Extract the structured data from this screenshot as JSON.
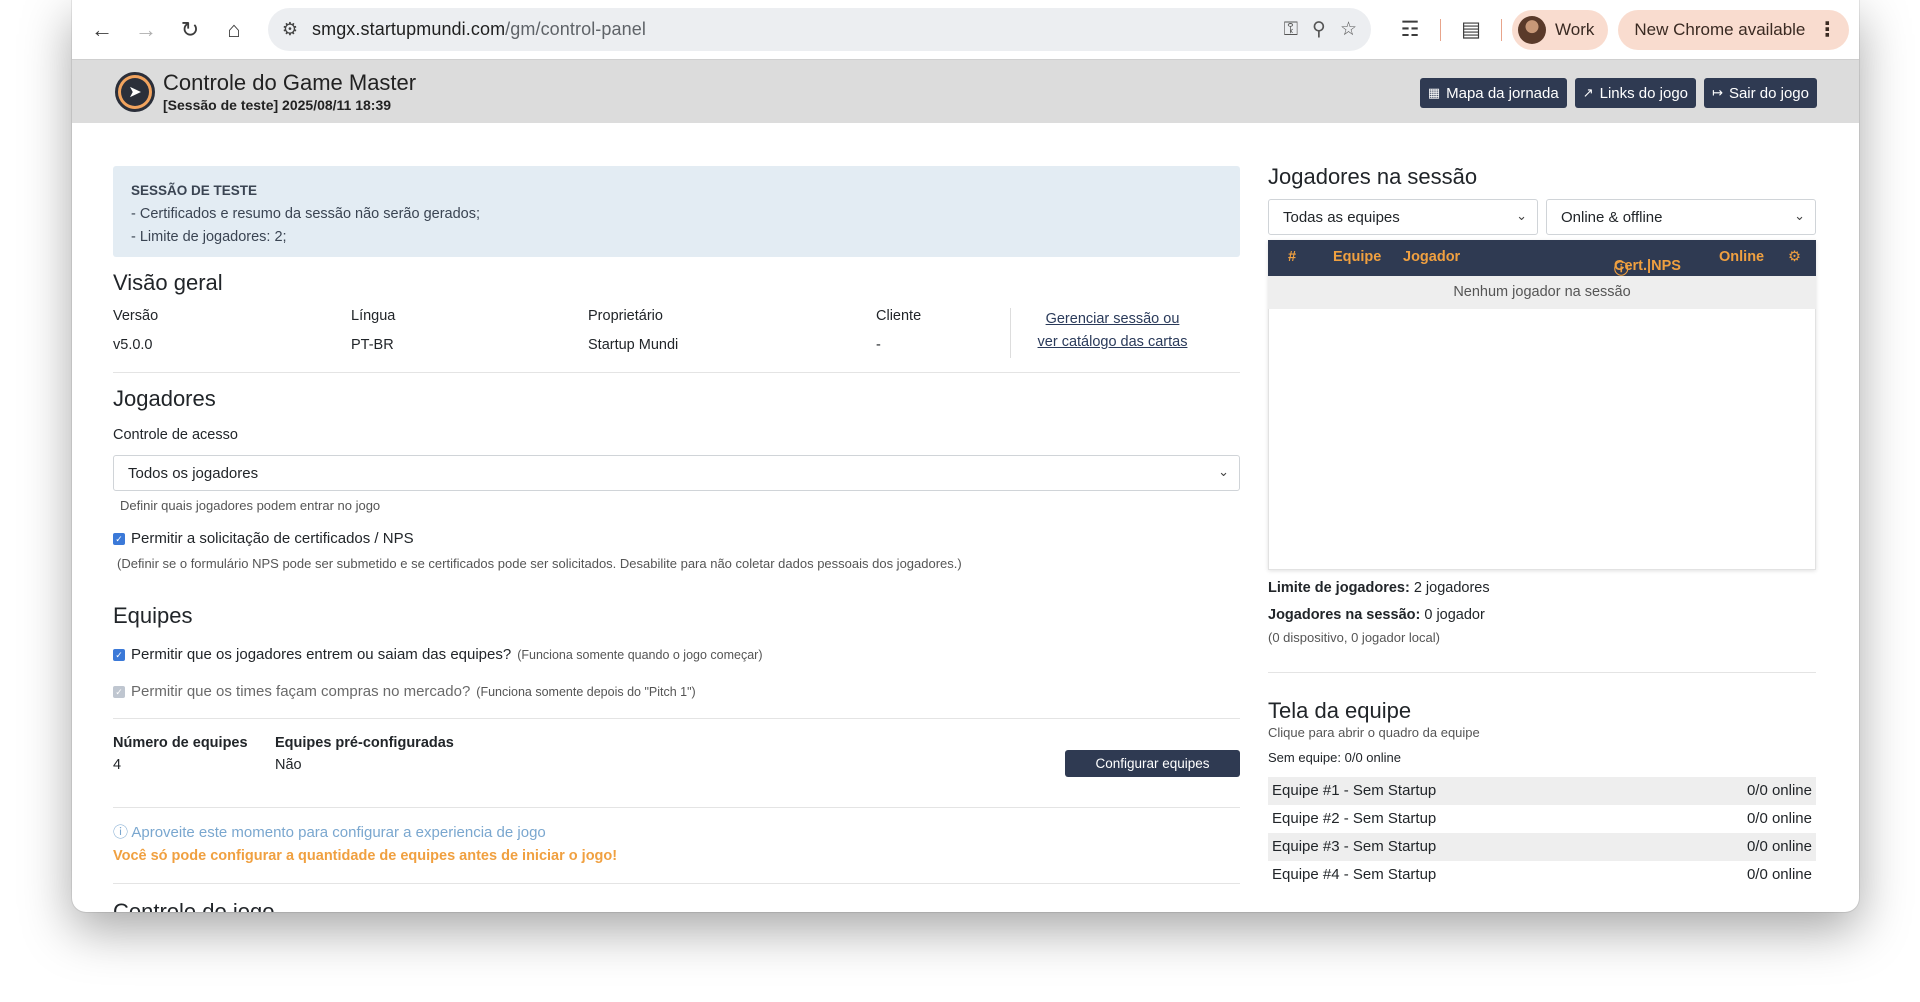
{
  "browser": {
    "url_host": "smgx.startupmundi.com",
    "url_path": "/gm/control-panel",
    "profile": "Work",
    "update_label": "New Chrome available"
  },
  "header": {
    "title": "Controle do Game Master",
    "subtitle": "[Sessão de teste] 2025/08/11 18:39",
    "buttons": [
      "Mapa da jornada",
      "Links do jogo",
      "Sair do jogo"
    ]
  },
  "alert": {
    "title": "SESSÃO DE TESTE",
    "lines": [
      "- Certificados e resumo da sessão não serão gerados;",
      "- Limite de jogadores: 2;"
    ]
  },
  "overview": {
    "heading": "Visão geral",
    "version_label": "Versão",
    "version": "v5.0.0",
    "language_label": "Língua",
    "language": "PT-BR",
    "owner_label": "Proprietário",
    "owner": "Startup Mundi",
    "client_label": "Cliente",
    "client": "-",
    "manage_link_1": "Gerenciar sessão ou",
    "manage_link_2": "ver catálogo das cartas"
  },
  "players": {
    "heading": "Jogadores",
    "access_label": "Controle de acesso",
    "access_value": "Todos os jogadores",
    "access_help": "Definir quais jogadores podem entrar no jogo",
    "nps_label": "Permitir a solicitação de certificados / NPS",
    "nps_help": "(Definir se o formulário NPS pode ser submetido e se certificados pode ser solicitados. Desabilite para não coletar dados pessoais dos jogadores.)"
  },
  "teams": {
    "heading": "Equipes",
    "join_label": "Permitir que os jogadores entrem ou saiam das equipes?",
    "join_note": "(Funciona somente quando o jogo começar)",
    "market_label": "Permitir que os times façam compras no mercado?",
    "market_note": "(Funciona somente depois do \"Pitch 1\")",
    "count_label": "Número de equipes",
    "count": "4",
    "preconf_label": "Equipes pré-configuradas",
    "preconf": "Não",
    "configure_button": "Configurar equipes",
    "info": "Aproveite este momento para configurar a experiencia de jogo",
    "warning": "Você só pode configurar a quantidade de equipes antes de iniciar o jogo!",
    "next_heading": "Controle do jogo"
  },
  "session_players": {
    "heading": "Jogadores na sessão",
    "team_filter": "Todas as equipes",
    "status_filter": "Online & offline",
    "columns": [
      "#",
      "Equipe",
      "Jogador",
      "Cert.|NPS",
      "Online"
    ],
    "empty": "Nenhum jogador na sessão",
    "limit_label": "Limite de jogadores:",
    "limit_value": "2 jogadores",
    "in_session_label": "Jogadores na sessão:",
    "in_session_value": "0 jogador",
    "devices_note": "(0 dispositivo, 0 jogador local)"
  },
  "team_screen": {
    "heading": "Tela da equipe",
    "subheading": "Clique para abrir o quadro da equipe",
    "no_team_label": "Sem equipe:",
    "no_team_value": "0/0 online",
    "rows": [
      {
        "name": "Equipe #1 - Sem Startup",
        "online": "0/0 online"
      },
      {
        "name": "Equipe #2 - Sem Startup",
        "online": "0/0 online"
      },
      {
        "name": "Equipe #3 - Sem Startup",
        "online": "0/0 online"
      },
      {
        "name": "Equipe #4 - Sem Startup",
        "online": "0/0 online"
      }
    ]
  },
  "colors": {
    "primary_dark": "#2f3a52",
    "accent_orange": "#f0a040",
    "info_blue": "#7aa7cf",
    "alert_bg": "#e3ecf3"
  }
}
